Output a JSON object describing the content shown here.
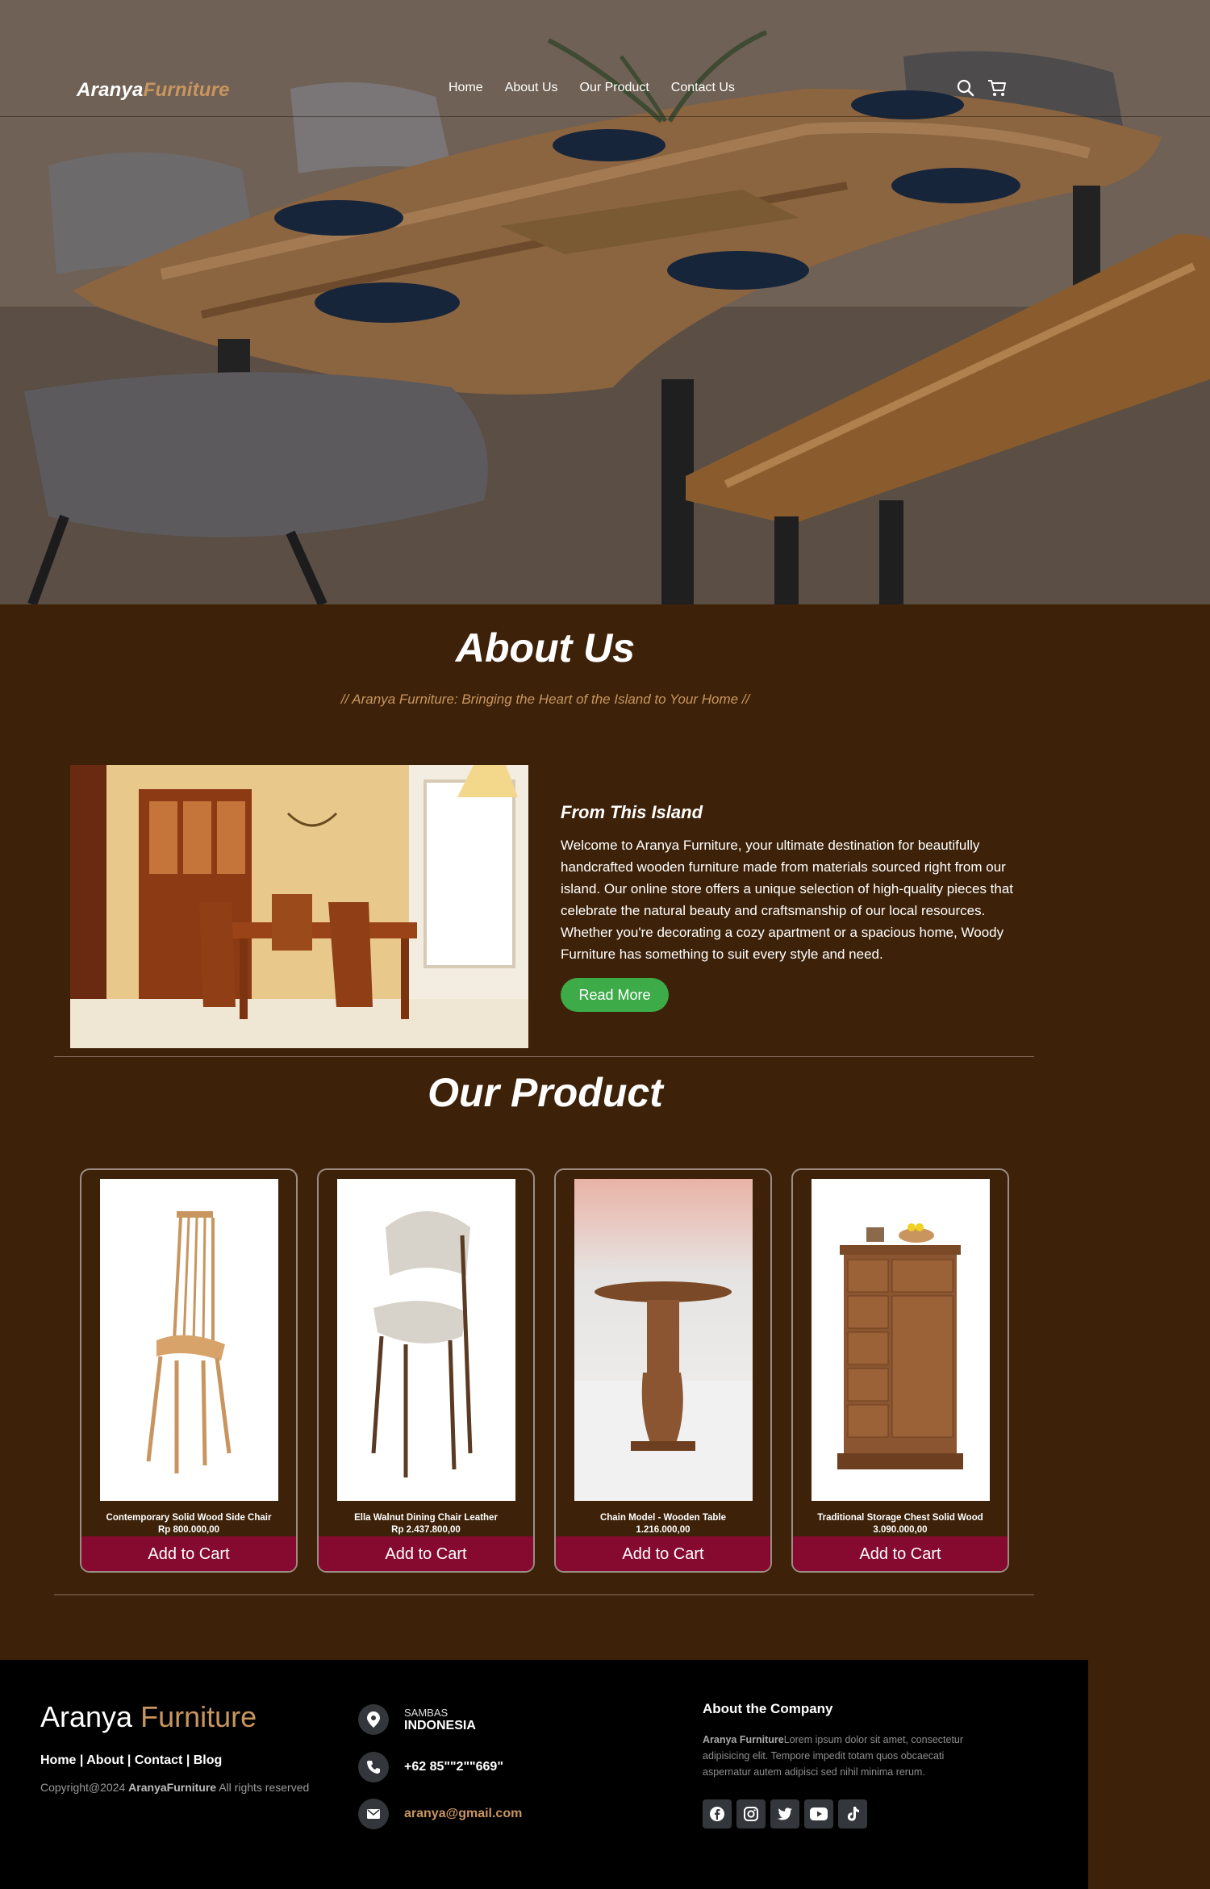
{
  "header": {
    "logo_part1": "Aranya",
    "logo_part2": "Furniture",
    "nav": [
      "Home",
      "About Us",
      "Our Product",
      "Contact Us"
    ],
    "icons": [
      "search-icon",
      "cart-icon"
    ]
  },
  "about": {
    "title": "About Us",
    "subtitle": "// Aranya Furniture: Bringing the Heart of the Island to Your Home //",
    "heading": "From This Island",
    "body": "Welcome to Aranya Furniture, your ultimate destination for beautifully handcrafted wooden furniture made from materials sourced right from our island. Our online store offers a unique selection of high-quality pieces that celebrate the natural beauty and craftsmanship of our local resources. Whether you're decorating a cozy apartment or a spacious home, Woody Furniture has something to suit every style and need.",
    "button": "Read More"
  },
  "products": {
    "title": "Our Product",
    "items": [
      {
        "name": "Contemporary Solid Wood Side Chair",
        "price": "Rp 800.000,00",
        "button": "Add to Cart"
      },
      {
        "name": "Ella Walnut Dining Chair Leather",
        "price": "Rp 2.437.800,00",
        "button": "Add to Cart"
      },
      {
        "name": "Chain Model - Wooden Table",
        "price": "1.216.000,00",
        "button": "Add to Cart"
      },
      {
        "name": "Traditional Storage Chest Solid Wood",
        "price": "3.090.000,00",
        "button": "Add to Cart"
      }
    ]
  },
  "footer": {
    "logo_part1": "Aranya",
    "logo_part2": "Furniture",
    "links": [
      "Home",
      "About",
      "Contact",
      "Blog"
    ],
    "copyright_prefix": "Copyright@2024",
    "copyright_brand": "AranyaFurniture",
    "copyright_suffix": "All rights reserved",
    "location_small": "SAMBAS",
    "location_big": "INDONESIA",
    "phone": "+62 85\"\"2\"\"669\"",
    "email": "aranya@gmail.com",
    "about_heading": "About the Company",
    "about_brand": "Aranya Furniture",
    "about_text": "Lorem ipsum dolor sit amet, consectetur adipisicing elit. Tempore impedit totam quos obcaecati aspernatur autem adipisci sed nihil minima rerum.",
    "social": [
      "facebook-icon",
      "instagram-icon",
      "twitter-icon",
      "youtube-icon",
      "tiktok-icon"
    ]
  },
  "colors": {
    "background": "#3d2209",
    "accent": "#c9955f",
    "read_more": "#3dab48",
    "cart_button": "#86092f",
    "footer": "#000000"
  }
}
